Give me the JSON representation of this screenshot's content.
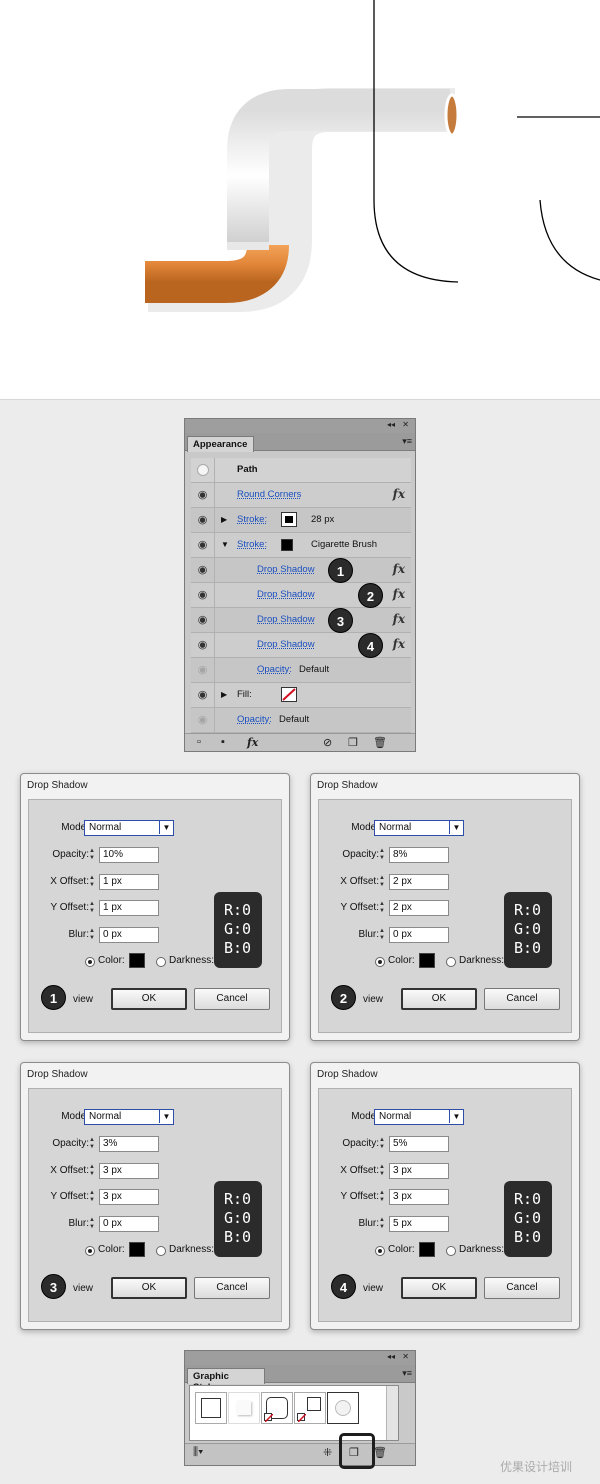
{
  "appearance": {
    "title": "Appearance",
    "object": "Path",
    "rows": [
      {
        "label": "Round Corners",
        "has_fx": true
      },
      {
        "label": "Stroke:",
        "value": "28 px"
      },
      {
        "label": "Stroke:",
        "value": "Cigarette Brush"
      },
      {
        "label": "Drop Shadow",
        "has_fx": true,
        "badge": "1"
      },
      {
        "label": "Drop Shadow",
        "has_fx": true,
        "badge": "2"
      },
      {
        "label": "Drop Shadow",
        "has_fx": true,
        "badge": "3"
      },
      {
        "label": "Drop Shadow",
        "has_fx": true,
        "badge": "4"
      },
      {
        "label": "Opacity:",
        "value": "Default"
      },
      {
        "label": "Fill:"
      },
      {
        "label": "Opacity:",
        "value": "Default"
      }
    ],
    "bottom_fx": "fx"
  },
  "dialogs": [
    {
      "title": "Drop Shadow",
      "mode": "Normal",
      "opacity": "10%",
      "x_offset": "1 px",
      "y_offset": "1 px",
      "blur": "0 px",
      "badge": "1"
    },
    {
      "title": "Drop Shadow",
      "mode": "Normal",
      "opacity": "8%",
      "x_offset": "2 px",
      "y_offset": "2 px",
      "blur": "0 px",
      "badge": "2"
    },
    {
      "title": "Drop Shadow",
      "mode": "Normal",
      "opacity": "3%",
      "x_offset": "3 px",
      "y_offset": "3 px",
      "blur": "0 px",
      "badge": "3"
    },
    {
      "title": "Drop Shadow",
      "mode": "Normal",
      "opacity": "5%",
      "x_offset": "3 px",
      "y_offset": "3 px",
      "blur": "5 px",
      "badge": "4"
    }
  ],
  "dialog_labels": {
    "mode": "Mode:",
    "opacity": "Opacity:",
    "x_offset": "X Offset:",
    "y_offset": "Y Offset:",
    "blur": "Blur:",
    "color": "Color:",
    "darkness": "Darkness:",
    "preview": "view",
    "ok": "OK",
    "cancel": "Cancel"
  },
  "rgb": {
    "r": "R:0",
    "g": "G:0",
    "b": "B:0"
  },
  "graphic_styles": {
    "title": "Graphic Styles"
  },
  "watermark": "优果设计培训",
  "colors": {
    "filter": "#e2873a",
    "paper": "#ffffff",
    "panel": "#c9c9c9",
    "link": "#1a4fc0"
  }
}
